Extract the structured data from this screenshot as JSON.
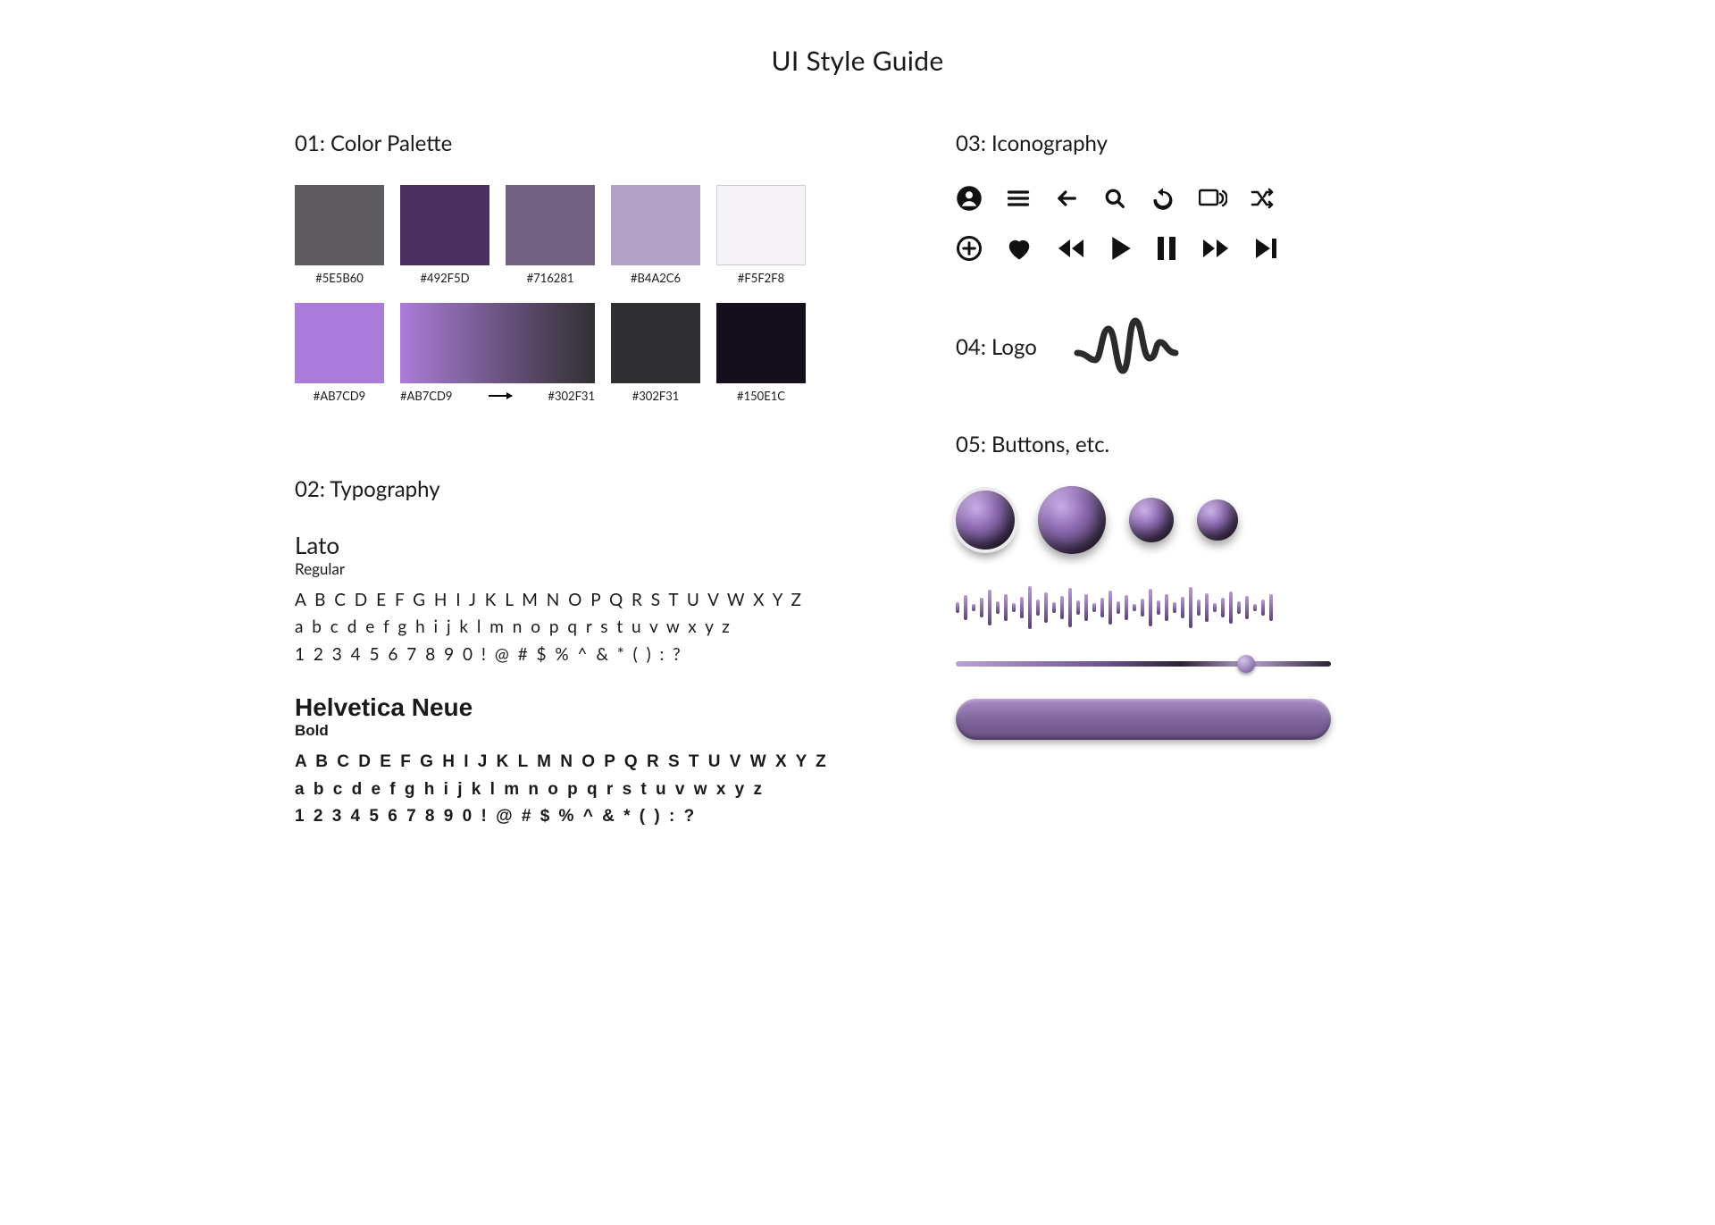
{
  "title": "UI Style Guide",
  "section1": {
    "title": "01: Color Palette",
    "row1": [
      {
        "hex": "#5E5B60"
      },
      {
        "hex": "#492F5D"
      },
      {
        "hex": "#716281"
      },
      {
        "hex": "#B4A2C6"
      },
      {
        "hex": "#F5F2F8"
      }
    ],
    "row2": {
      "solid": {
        "hex": "#AB7CD9"
      },
      "gradient": {
        "from": "#AB7CD9",
        "to": "#302F31"
      },
      "solid2": {
        "hex": "#302F31"
      },
      "solid3": {
        "hex": "#150E1C"
      }
    }
  },
  "section2": {
    "title": "02: Typography",
    "fonts": [
      {
        "name": "Lato",
        "weight": "Regular",
        "lines": [
          "A B C D E F G H I J K L M N O P Q R S T U V W X Y Z",
          "a b c d e f g h i j k l m n o p q r s t u v w x y z",
          "1 2 3 4 5 6 7 8 9 0 ! @ # $ % ^ & * ( ) : ?"
        ]
      },
      {
        "name": "Helvetica Neue",
        "weight": "Bold",
        "lines": [
          "A B C D E F G H I J K L M N O P Q R S T U V W X Y Z",
          "a b c d e f g h i j k l m n o p q r s t u v w x y z",
          "1 2 3 4 5 6 7 8 9 0 ! @ # $ % ^ & * ( ) : ?"
        ]
      }
    ]
  },
  "section3": {
    "title": "03: Iconography",
    "icons_row1": [
      "account",
      "menu",
      "back",
      "search",
      "replay",
      "cast",
      "shuffle"
    ],
    "icons_row2": [
      "add",
      "heart",
      "rewind",
      "play",
      "pause",
      "forward",
      "skip-next"
    ]
  },
  "section4": {
    "title": "04: Logo"
  },
  "section5": {
    "title": "05: Buttons, etc."
  }
}
